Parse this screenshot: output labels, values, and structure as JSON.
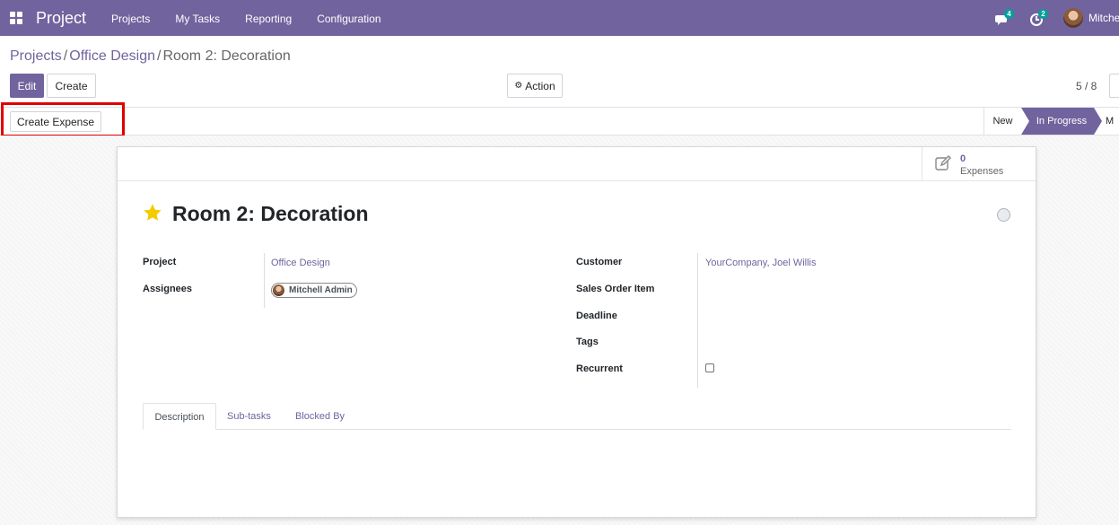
{
  "navbar": {
    "app_name": "Project",
    "menu": [
      "Projects",
      "My Tasks",
      "Reporting",
      "Configuration"
    ],
    "messages_count": "4",
    "activities_count": "2",
    "user_name": "Mitchell Admin"
  },
  "breadcrumb": {
    "items": [
      "Projects",
      "Office Design"
    ],
    "current": "Room 2: Decoration"
  },
  "toolbar": {
    "edit_label": "Edit",
    "create_label": "Create",
    "action_label": "Action",
    "pager": "5 / 8"
  },
  "statusbar": {
    "create_expense_label": "Create Expense",
    "stages": [
      "New",
      "In Progress",
      "M"
    ]
  },
  "smart_button": {
    "count": "0",
    "label": "Expenses"
  },
  "record": {
    "title": "Room 2: Decoration",
    "fields_left": {
      "project_label": "Project",
      "project_value": "Office Design",
      "assignees_label": "Assignees",
      "assignee": "Mitchell Admin"
    },
    "fields_right": {
      "customer_label": "Customer",
      "customer_value": "YourCompany, Joel Willis",
      "sales_order_label": "Sales Order Item",
      "deadline_label": "Deadline",
      "tags_label": "Tags",
      "recurrent_label": "Recurrent"
    }
  },
  "tabs": [
    "Description",
    "Sub-tasks",
    "Blocked By"
  ],
  "colors": {
    "brand": "#71639e",
    "highlight": "#e00000",
    "star": "#f3cc00"
  }
}
